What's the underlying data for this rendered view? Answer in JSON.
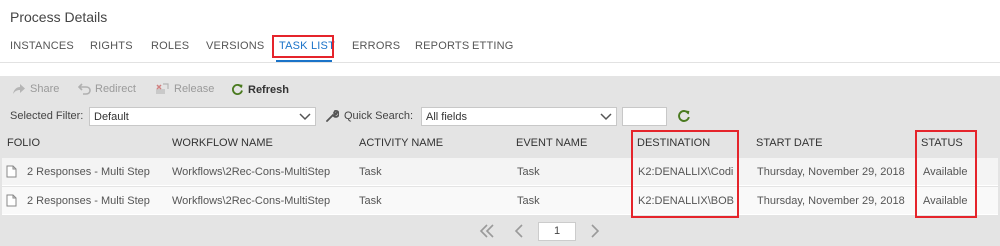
{
  "page": {
    "title": "Process Details"
  },
  "tabs": [
    {
      "label": "INSTANCES"
    },
    {
      "label": "RIGHTS"
    },
    {
      "label": "ROLES"
    },
    {
      "label": "VERSIONS"
    },
    {
      "label": "TASK LIST",
      "active": true
    },
    {
      "label": "ERRORS"
    },
    {
      "label": "REPORTS"
    },
    {
      "label": "ETTING"
    }
  ],
  "toolbar": {
    "share_label": "Share",
    "redirect_label": "Redirect",
    "release_label": "Release",
    "refresh_label": "Refresh",
    "refresh_color": "#4a7a1f"
  },
  "filters": {
    "selected_filter_label": "Selected Filter:",
    "selected_filter_value": "Default",
    "quick_search_label": "Quick Search:",
    "quick_search_value": "All fields",
    "search_text_value": ""
  },
  "columns": [
    "FOLIO",
    "WORKFLOW NAME",
    "ACTIVITY NAME",
    "EVENT NAME",
    "DESTINATION",
    "START DATE",
    "STATUS"
  ],
  "rows": [
    [
      "2 Responses - Multi Step",
      "Workflows\\2Rec-Cons-MultiStep",
      "Task",
      "Task",
      "K2:DENALLIX\\Codi",
      "Thursday, November 29, 2018",
      "Available"
    ],
    [
      "2 Responses - Multi Step",
      "Workflows\\2Rec-Cons-MultiStep",
      "Task",
      "Task",
      "K2:DENALLIX\\BOB",
      "Thursday, November 29, 2018",
      "Available"
    ]
  ],
  "pager": {
    "current_page": "1"
  },
  "colors": {
    "highlight": "#e5242b",
    "active_tab": "#1a73c8"
  }
}
